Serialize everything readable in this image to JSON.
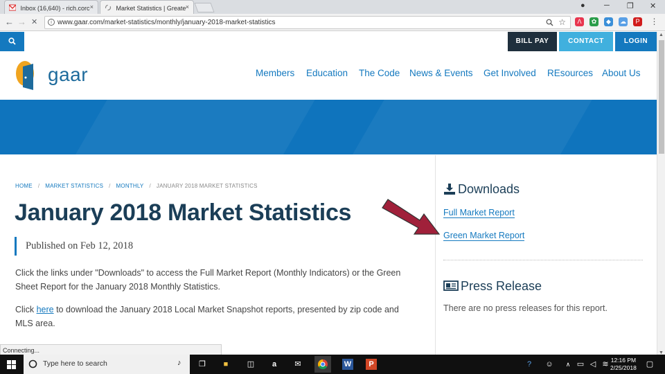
{
  "browser": {
    "tabs": [
      {
        "label": "Inbox (16,640) - rich.corc",
        "close": "×"
      },
      {
        "label": "Market Statistics | Greate",
        "close": "×"
      }
    ],
    "window_controls": {
      "user": "●",
      "minimize": "─",
      "restore": "❐",
      "close": "✕"
    },
    "nav": {
      "back": "←",
      "forward": "→",
      "reload": "✕"
    },
    "url": "www.gaar.com/market-statistics/monthly/january-2018-market-statistics",
    "status": "Connecting..."
  },
  "site": {
    "topbar": {
      "search_icon": "⚲",
      "bill_pay": "BILL PAY",
      "contact": "CONTACT",
      "login": "LOGIN"
    },
    "logo_text": "gaar",
    "nav": [
      "Members",
      "Education",
      "The Code",
      "News & Events",
      "Get Involved",
      "REsources",
      "About Us"
    ],
    "breadcrumb": [
      "HOME",
      "MARKET STATISTICS",
      "MONTHLY",
      "JANUARY 2018 MARKET STATISTICS"
    ],
    "breadcrumb_sep": "/",
    "title": "January 2018 Market Statistics",
    "published": "Published on Feb 12, 2018",
    "para1": "Click the links under \"Downloads\" to access the Full Market Report (Monthly Indicators) or the Green Sheet Report for the January 2018 Monthly Statistics.",
    "para2_before": "Click ",
    "para2_link": "here",
    "para2_after": " to download the January 2018 Local Market Snapshot reports, presented by zip code and MLS area.",
    "sidebar": {
      "downloads_heading": "Downloads",
      "full_report": "Full Market Report",
      "green_report": "Green Market Report",
      "press_heading": "Press Release",
      "press_text": "There are no press releases for this report."
    }
  },
  "taskbar": {
    "search_placeholder": "Type here to search",
    "time": "12:16 PM",
    "date": "2/25/2018"
  },
  "colors": {
    "brand_blue": "#1479bf",
    "dark_navy": "#1b3e57",
    "bill_pay": "#1f2f3d",
    "contact": "#40b0de",
    "login": "#1479bf",
    "arrow": "#a0203a"
  }
}
